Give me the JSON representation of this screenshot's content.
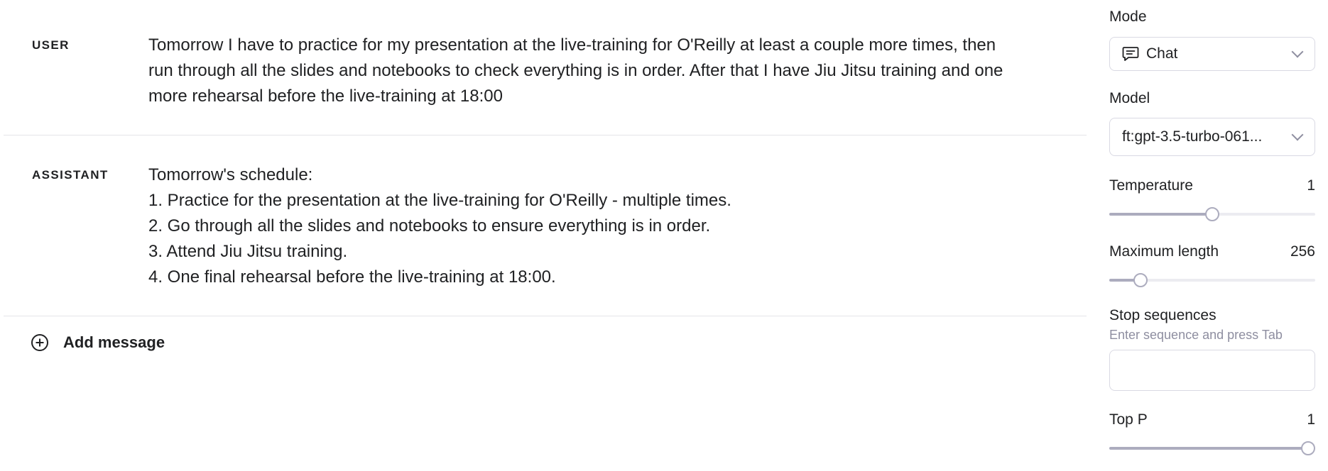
{
  "messages": [
    {
      "role": "USER",
      "lines": [
        "Tomorrow I have to practice for my presentation at the live-training for O'Reilly at least a couple more times, then",
        "run through all the slides and notebooks to check everything is in order. After that I have Jiu Jitsu training and one",
        "more rehearsal before the live-training at 18:00"
      ]
    },
    {
      "role": "ASSISTANT",
      "lines": [
        "Tomorrow's schedule:",
        "1. Practice for the presentation at the live-training for O'Reilly - multiple times.",
        "2. Go through all the slides and notebooks to ensure everything is in order.",
        "3. Attend Jiu Jitsu training.",
        "4. One final rehearsal before the live-training at 18:00."
      ]
    }
  ],
  "add_message": {
    "label": "Add message",
    "icon": "plus-circle-icon"
  },
  "settings": {
    "mode": {
      "label": "Mode",
      "value": "Chat",
      "icon": "chat-icon"
    },
    "model": {
      "label": "Model",
      "value": "ft:gpt-3.5-turbo-061..."
    },
    "temperature": {
      "label": "Temperature",
      "value": "1",
      "fraction": 0.5
    },
    "maximum_length": {
      "label": "Maximum length",
      "value": "256",
      "fraction": 0.125
    },
    "stop_sequences": {
      "label": "Stop sequences",
      "hint": "Enter sequence and press Tab",
      "value": ""
    },
    "top_p": {
      "label": "Top P",
      "value": "1",
      "fraction": 1.0
    }
  },
  "colors": {
    "text": "#202123",
    "muted": "#8e8ea0",
    "border": "#d9d9e3",
    "slider_track": "#ececf1",
    "slider_fill": "#acacbe"
  }
}
